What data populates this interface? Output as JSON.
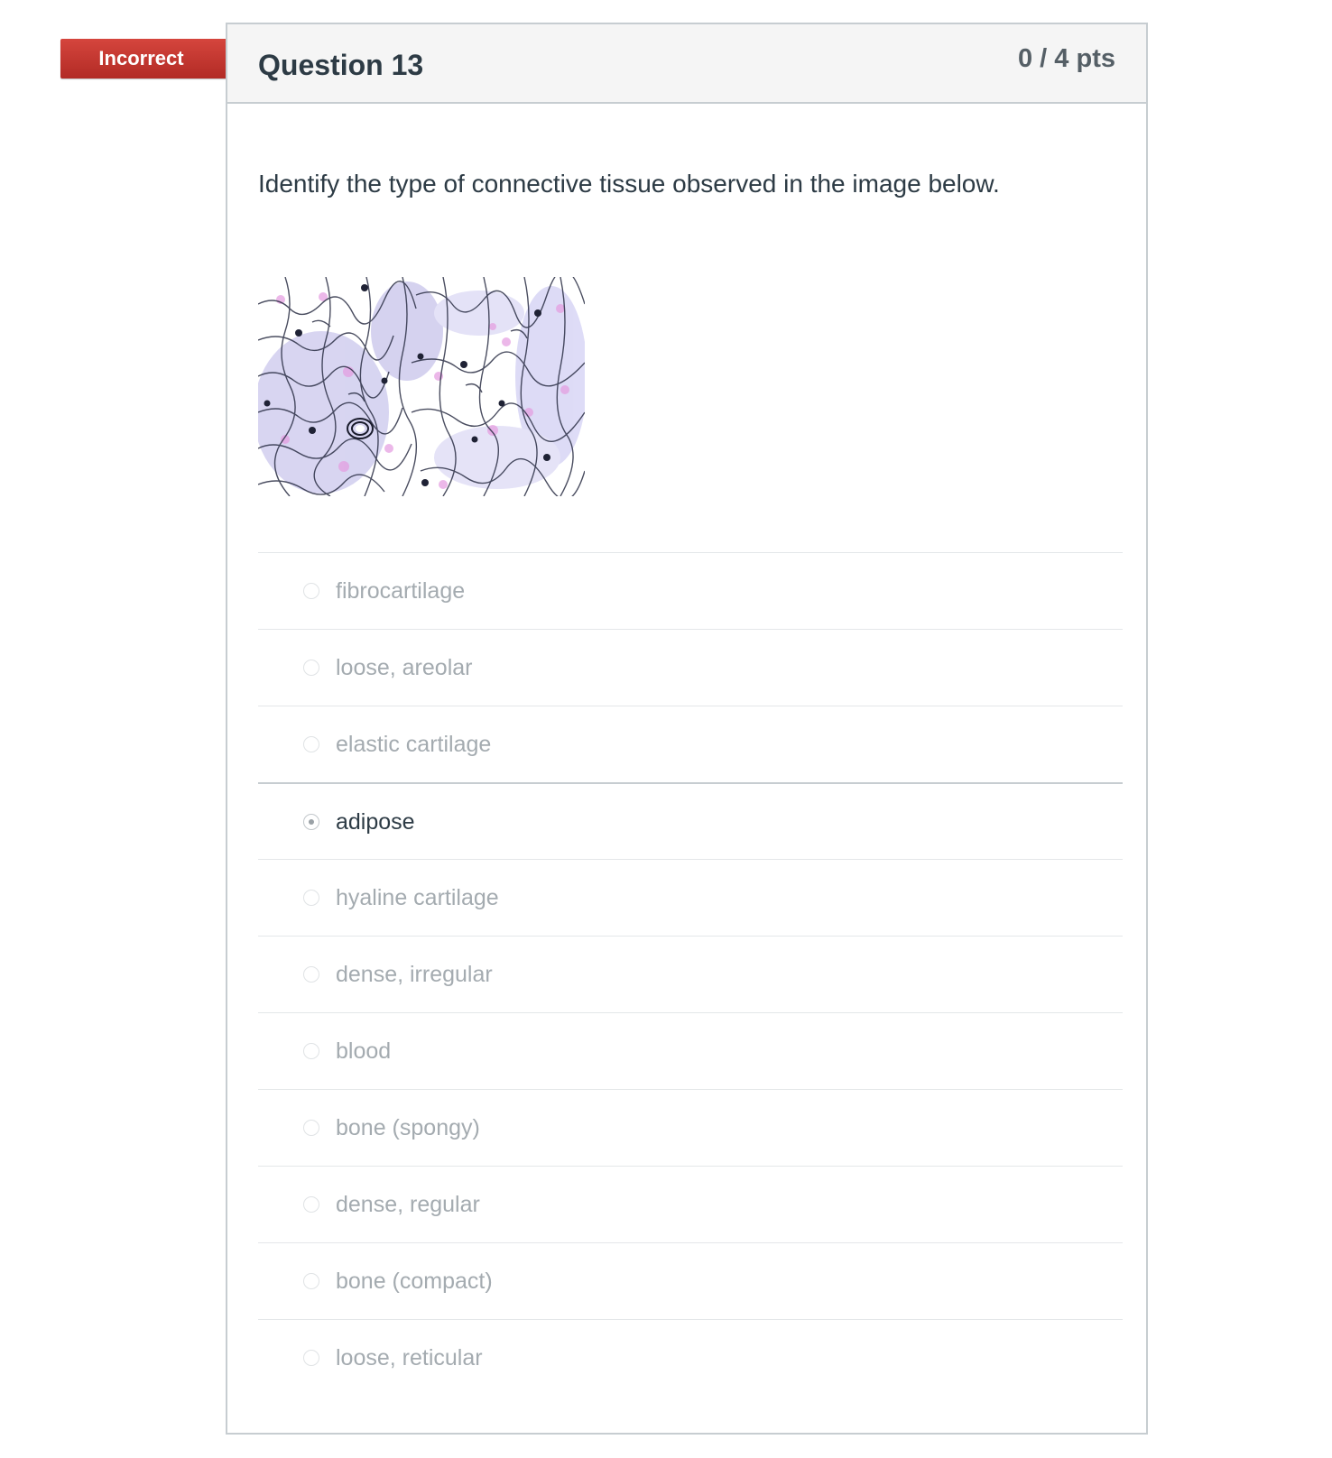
{
  "status_ribbon": "Incorrect",
  "question": {
    "title": "Question 13",
    "points": "0 / 4 pts",
    "text": "Identify the type of connective tissue observed in the image below.",
    "image_subject": "histology-micrograph-image"
  },
  "answers": [
    {
      "label": "fibrocartilage",
      "selected": false
    },
    {
      "label": "loose, areolar",
      "selected": false
    },
    {
      "label": "elastic cartilage",
      "selected": false
    },
    {
      "label": "adipose",
      "selected": true
    },
    {
      "label": "hyaline cartilage",
      "selected": false
    },
    {
      "label": "dense, irregular",
      "selected": false
    },
    {
      "label": "blood",
      "selected": false
    },
    {
      "label": "bone (spongy)",
      "selected": false
    },
    {
      "label": "dense, regular",
      "selected": false
    },
    {
      "label": "bone (compact)",
      "selected": false
    },
    {
      "label": "loose, reticular",
      "selected": false
    }
  ],
  "colors": {
    "ribbon": "#c2352f",
    "header_bg": "#f5f5f5",
    "text": "#2d3b45",
    "muted_text": "#a4abb0"
  }
}
